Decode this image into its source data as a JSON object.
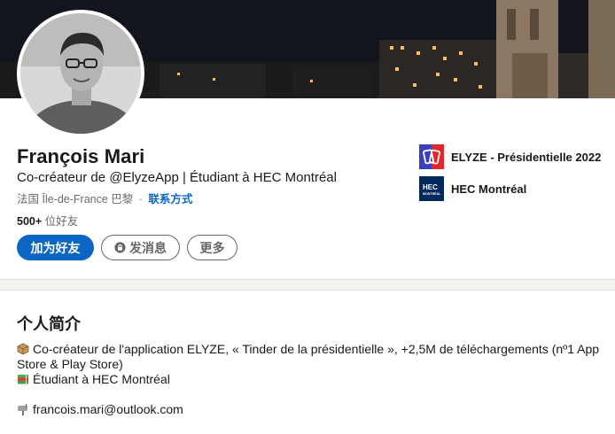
{
  "profile": {
    "name": "François Mari",
    "headline": "Co-créateur de @ElyzeApp | Étudiant à HEC Montréal",
    "location": "法国 Île-de-France 巴黎",
    "separator": "·",
    "contact_label": "联系方式",
    "connections_count": "500+",
    "connections_label": " 位好友"
  },
  "actions": {
    "connect_label": "加为好友",
    "message_label": "发消息",
    "more_label": "更多"
  },
  "organizations": [
    {
      "name": "ELYZE - Présidentielle 2022",
      "logo_icon": "elyze-logo",
      "color": "#e3262b"
    },
    {
      "name": "HEC Montréal",
      "logo_icon": "hec-logo",
      "color": "#002a5c",
      "logo_text": "HEC",
      "logo_subtext": "MONTRÉAL"
    }
  ],
  "about": {
    "title": "个人简介",
    "line1": "Co-créateur de l'application ELYZE, « Tinder de la présidentielle », +2,5M de téléchargements (nº1 App Store & Play Store)",
    "line1_icon": "package-icon",
    "line2": "Étudiant à HEC Montréal",
    "line2_icon": "books-icon",
    "line3": "francois.mari@outlook.com",
    "line3_icon": "mailbox-icon"
  },
  "colors": {
    "primary": "#0a66c2",
    "elyze_red": "#e3262b",
    "elyze_blue": "#3b3fbf",
    "hec_navy": "#002a5c"
  }
}
